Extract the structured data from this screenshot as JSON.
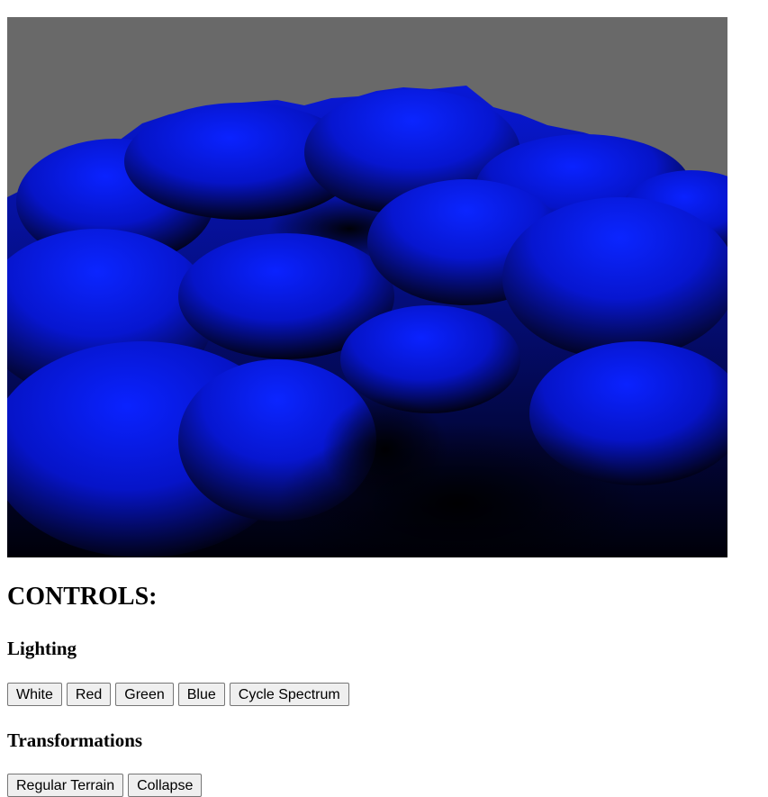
{
  "viewport": {
    "scene": "3d-terrain-render",
    "colors": {
      "sky": "#696969",
      "terrain_light": "#0a1eff",
      "terrain_mid": "#0612b0",
      "terrain_dark": "#000000"
    }
  },
  "controls": {
    "title": "CONTROLS:",
    "lighting": {
      "heading": "Lighting",
      "buttons": [
        "White",
        "Red",
        "Green",
        "Blue",
        "Cycle Spectrum"
      ]
    },
    "transformations": {
      "heading": "Transformations",
      "buttons": [
        "Regular Terrain",
        "Collapse"
      ]
    }
  }
}
